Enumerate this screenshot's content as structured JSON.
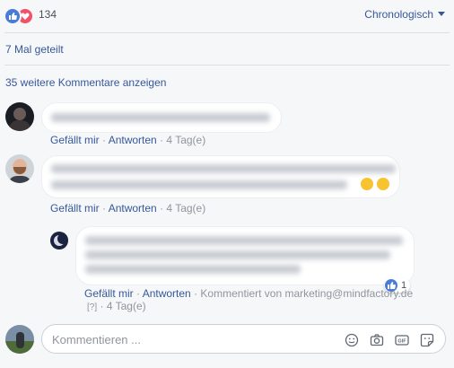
{
  "reactions": {
    "count": "134"
  },
  "sort": {
    "label": "Chronologisch"
  },
  "shares": {
    "label": "7 Mal geteilt"
  },
  "more_comments": {
    "label": "35 weitere Kommentare anzeigen"
  },
  "comments": [
    {
      "actions": {
        "like": "Gefällt mir",
        "reply": "Antworten",
        "time": "4 Tag(e)",
        "sep": "·"
      }
    },
    {
      "actions": {
        "like": "Gefällt mir",
        "reply": "Antworten",
        "time": "4 Tag(e)",
        "sep": "·"
      }
    }
  ],
  "reply": {
    "like_count": "1",
    "actions": {
      "like": "Gefällt mir",
      "reply": "Antworten",
      "commented_by": "Kommentiert von marketing@mindfactory.de",
      "help": "[?]",
      "time": "4 Tag(e)",
      "sep": "·"
    }
  },
  "composer": {
    "placeholder": "Kommentieren ..."
  },
  "colors": {
    "link": "#365899",
    "meta": "#90949c",
    "like_blue": "#4a7bd6",
    "love_red": "#f25268"
  }
}
